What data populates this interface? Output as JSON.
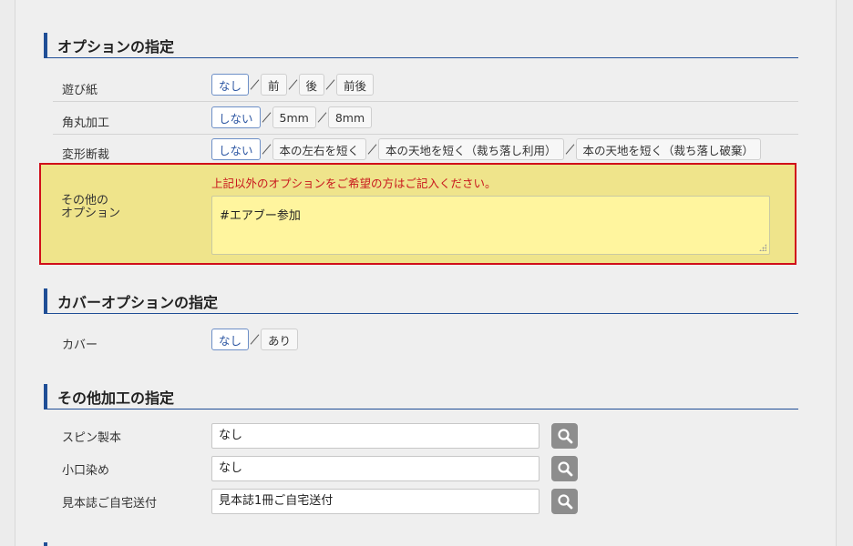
{
  "sections": {
    "options_title": "オプションの指定",
    "cover_title": "カバーオプションの指定",
    "other_processing_title": "その他加工の指定"
  },
  "options": {
    "endpaper": {
      "label": "遊び紙",
      "choices": [
        "なし",
        "前",
        "後",
        "前後"
      ],
      "selected": "なし"
    },
    "corner": {
      "label": "角丸加工",
      "choices": [
        "しない",
        "5mm",
        "8mm"
      ],
      "selected": "しない"
    },
    "trim": {
      "label": "変形断裁",
      "choices": [
        "しない",
        "本の左右を短く",
        "本の天地を短く（裁ち落し利用）",
        "本の天地を短く（裁ち落し破棄）"
      ],
      "selected": "しない"
    },
    "other": {
      "label_line1": "その他の",
      "label_line2": "オプション",
      "note": "上記以外のオプションをご希望の方はご記入ください。",
      "value": "#エアブー参加"
    }
  },
  "cover": {
    "label": "カバー",
    "choices": [
      "なし",
      "あり"
    ],
    "selected": "なし"
  },
  "processing": {
    "spine": {
      "label": "スピン製本",
      "value": "なし"
    },
    "edge": {
      "label": "小口染め",
      "value": "なし"
    },
    "sample": {
      "label": "見本誌ご自宅送付",
      "value": "見本誌1冊ご自宅送付"
    }
  },
  "colors": {
    "accent": "#1f4e96",
    "selected_text": "#2c56a2",
    "note_red": "#c8161d",
    "highlight_bg": "#efe48b",
    "textarea_bg": "#fff59e"
  },
  "icons": {
    "search": "magnifier-icon"
  }
}
